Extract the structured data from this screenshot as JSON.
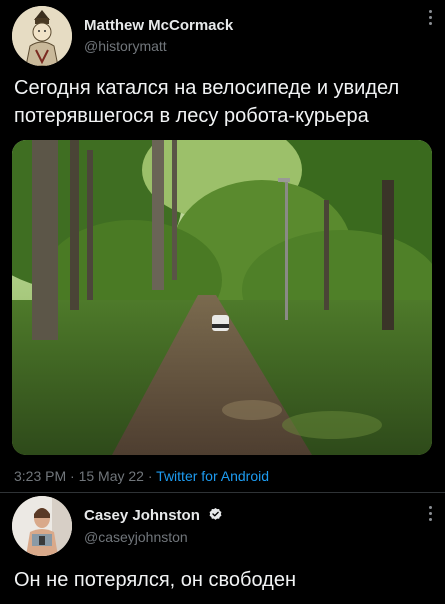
{
  "tweet1": {
    "author_name": "Matthew McCormack",
    "author_handle": "@historymatt",
    "text_line1": "Сегодня катался на велосипеде и увидел",
    "text_line2": "потерявшегося в лесу робота-курьера",
    "time": "3:23 PM",
    "sep1": "·",
    "date": "15 May 22",
    "sep2": "·",
    "source": "Twitter for Android"
  },
  "tweet2": {
    "author_name": "Casey Johnston",
    "author_handle": "@caseyjohnston",
    "text": "Он не потерялся, он свободен"
  },
  "colors": {
    "background": "#000000",
    "text": "#e7e9ea",
    "secondary": "#71767b",
    "link": "#1d9bf0"
  }
}
